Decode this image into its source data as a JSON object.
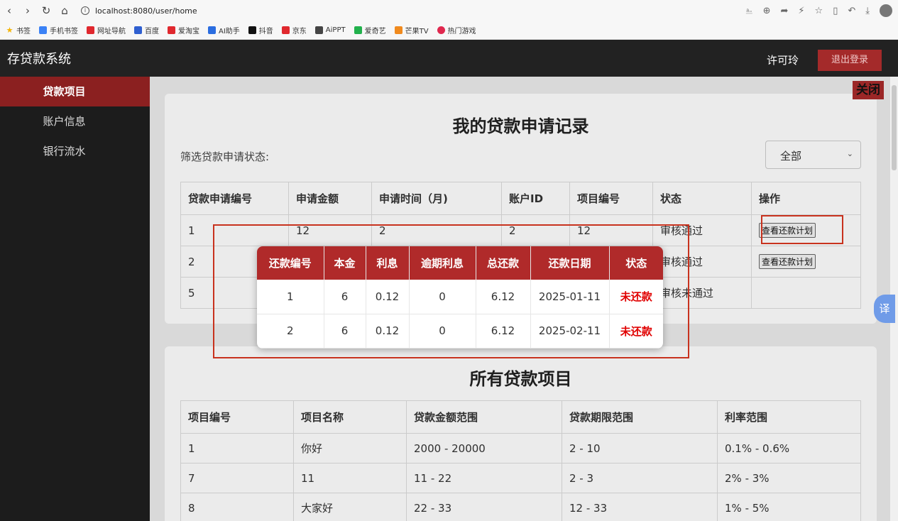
{
  "browser": {
    "url": "localhost:8080/user/home",
    "bookmarks": [
      "书签",
      "手机书签",
      "网址导航",
      "百度",
      "爱淘宝",
      "AI助手",
      "抖音",
      "京东",
      "AiPPT",
      "爱奇艺",
      "芒果TV",
      "热门游戏"
    ]
  },
  "header": {
    "app_title": "存贷款系统",
    "username": "许可玲",
    "logout": "退出登录"
  },
  "sidebar": {
    "items": [
      {
        "label": "贷款项目"
      },
      {
        "label": "账户信息"
      },
      {
        "label": "银行流水"
      }
    ]
  },
  "applications": {
    "title": "我的贷款申请记录",
    "filter_label": "筛选贷款申请状态:",
    "filter_value": "全部",
    "columns": [
      "贷款申请编号",
      "申请金额",
      "申请时间（月)",
      "账户ID",
      "项目编号",
      "状态",
      "操作"
    ],
    "rows": [
      [
        "1",
        "12",
        "2",
        "2",
        "12",
        "审核通过",
        "查看还款计划"
      ],
      [
        "2",
        "",
        "",
        "",
        "",
        "审核通过",
        "查看还款计划"
      ],
      [
        "5",
        "",
        "",
        "",
        "",
        "审核未通过",
        ""
      ]
    ]
  },
  "projects": {
    "title": "所有贷款项目",
    "columns": [
      "项目编号",
      "项目名称",
      "贷款金额范围",
      "贷款期限范围",
      "利率范围"
    ],
    "rows": [
      [
        "1",
        "你好",
        "2000 - 20000",
        "2 - 10",
        "0.1% - 0.6%"
      ],
      [
        "7",
        "11",
        "11 - 22",
        "2 - 3",
        "2% - 3%"
      ],
      [
        "8",
        "大家好",
        "22 - 33",
        "12 - 33",
        "1% - 5%"
      ]
    ]
  },
  "modal": {
    "close": "关闭",
    "columns": [
      "还款编号",
      "本金",
      "利息",
      "逾期利息",
      "总还款",
      "还款日期",
      "状态"
    ],
    "rows": [
      [
        "1",
        "6",
        "0.12",
        "0",
        "6.12",
        "2025-01-11",
        "未还款"
      ],
      [
        "2",
        "6",
        "0.12",
        "0",
        "6.12",
        "2025-02-11",
        "未还款"
      ]
    ]
  },
  "translate_label": "译",
  "colors": {
    "accent": "#a42a2a",
    "header_bg": "#222222",
    "unpaid": "#e00000"
  }
}
